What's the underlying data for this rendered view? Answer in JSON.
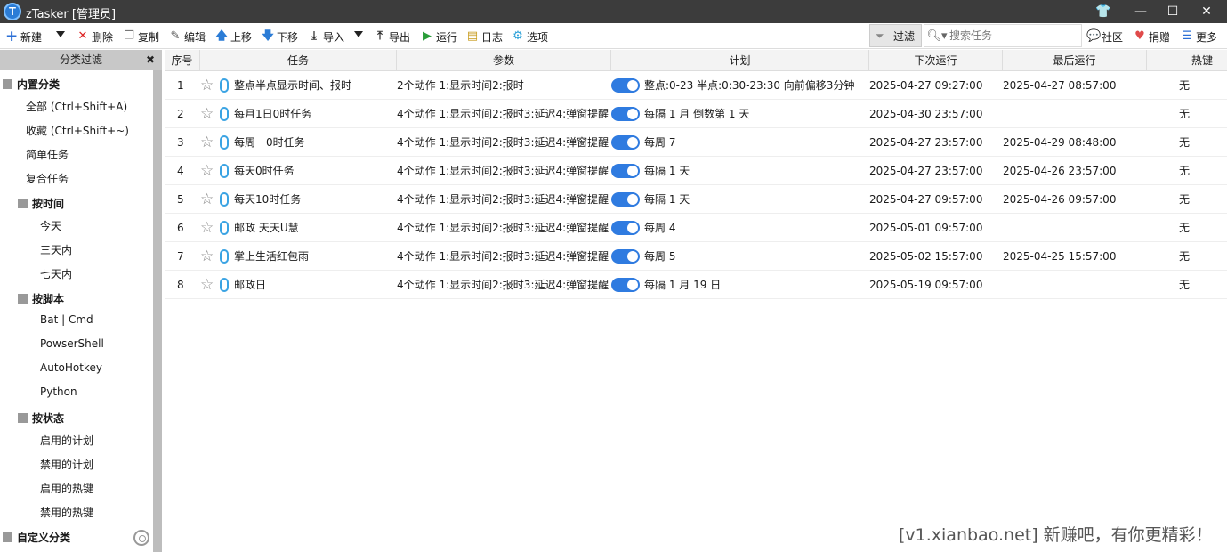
{
  "window": {
    "title": "zTasker [管理员]"
  },
  "toolbar": {
    "new": "新建",
    "delete": "删除",
    "copy": "复制",
    "edit": "编辑",
    "up": "上移",
    "down": "下移",
    "import": "导入",
    "export": "导出",
    "run": "运行",
    "log": "日志",
    "options": "选项",
    "filter": "过滤",
    "search_placeholder": "搜索任务",
    "community": "社区",
    "donate": "捐赠",
    "more": "更多"
  },
  "sidebar": {
    "header": "分类过滤",
    "builtin": "内置分类",
    "all": "全部 (Ctrl+Shift+A)",
    "fav": "收藏 (Ctrl+Shift+~)",
    "simple": "简单任务",
    "composite": "复合任务",
    "by_time": "按时间",
    "today": "今天",
    "three_days": "三天内",
    "seven_days": "七天内",
    "by_script": "按脚本",
    "bat": "Bat | Cmd",
    "ps": "PowserShell",
    "ahk": "AutoHotkey",
    "py": "Python",
    "by_status": "按状态",
    "en_plan": "启用的计划",
    "dis_plan": "禁用的计划",
    "en_hotkey": "启用的热键",
    "dis_hotkey": "禁用的热键",
    "custom": "自定义分类"
  },
  "columns": {
    "no": "序号",
    "task": "任务",
    "params": "参数",
    "plan": "计划",
    "next": "下次运行",
    "last": "最后运行",
    "hotkey": "热键"
  },
  "rows": [
    {
      "no": "1",
      "task": "整点半点显示时间、报时",
      "params": "2个动作 1:显示时间2:报时",
      "plan": "整点:0-23 半点:0:30-23:30 向前偏移3分钟",
      "next": "2025-04-27 09:27:00",
      "last": "2025-04-27 08:57:00",
      "hotkey": "无"
    },
    {
      "no": "2",
      "task": "每月1日0时任务",
      "params": "4个动作 1:显示时间2:报时3:延迟4:弹窗提醒",
      "plan": "每隔 1 月 倒数第 1 天",
      "next": "2025-04-30 23:57:00",
      "last": "",
      "hotkey": "无"
    },
    {
      "no": "3",
      "task": "每周一0时任务",
      "params": "4个动作 1:显示时间2:报时3:延迟4:弹窗提醒",
      "plan": "每周 7",
      "next": "2025-04-27 23:57:00",
      "last": "2025-04-29 08:48:00",
      "hotkey": "无"
    },
    {
      "no": "4",
      "task": "每天0时任务",
      "params": "4个动作 1:显示时间2:报时3:延迟4:弹窗提醒",
      "plan": "每隔 1 天",
      "next": "2025-04-27 23:57:00",
      "last": "2025-04-26 23:57:00",
      "hotkey": "无"
    },
    {
      "no": "5",
      "task": "每天10时任务",
      "params": "4个动作 1:显示时间2:报时3:延迟4:弹窗提醒",
      "plan": "每隔 1 天",
      "next": "2025-04-27 09:57:00",
      "last": "2025-04-26 09:57:00",
      "hotkey": "无"
    },
    {
      "no": "6",
      "task": "邮政  天天U慧",
      "params": "4个动作 1:显示时间2:报时3:延迟4:弹窗提醒",
      "plan": "每周 4",
      "next": "2025-05-01 09:57:00",
      "last": "",
      "hotkey": "无"
    },
    {
      "no": "7",
      "task": "掌上生活红包雨",
      "params": "4个动作 1:显示时间2:报时3:延迟4:弹窗提醒",
      "plan": "每周 5",
      "next": "2025-05-02 15:57:00",
      "last": "2025-04-25 15:57:00",
      "hotkey": "无"
    },
    {
      "no": "8",
      "task": "邮政日",
      "params": "4个动作 1:显示时间2:报时3:延迟4:弹窗提醒",
      "plan": "每隔 1 月 19 日",
      "next": "2025-05-19 09:57:00",
      "last": "",
      "hotkey": "无"
    }
  ],
  "watermark": "[v1.xianbao.net] 新赚吧，有你更精彩！"
}
